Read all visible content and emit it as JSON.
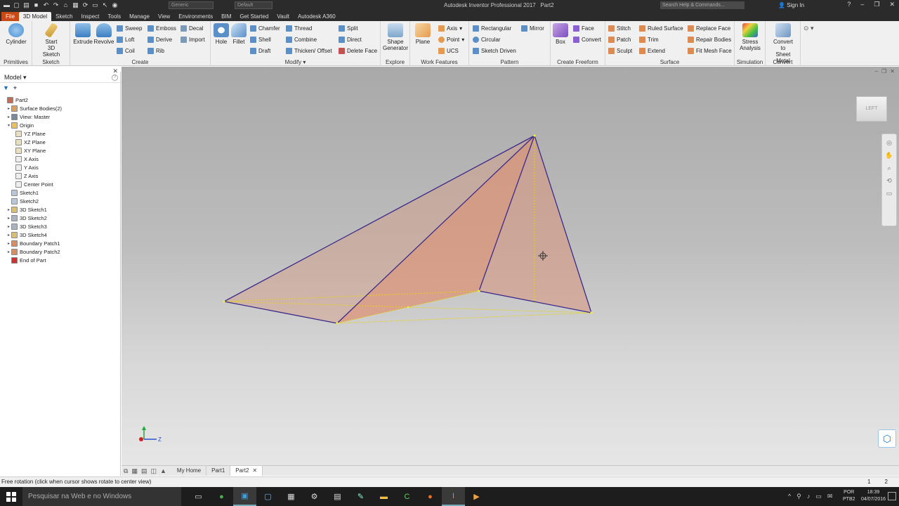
{
  "titlebar": {
    "appearance_combo": "Generic",
    "material_combo": "Default",
    "app_title": "Autodesk Inventor Professional 2017",
    "doc_title": "Part2",
    "search_placeholder": "Search Help & Commands...",
    "sign_in": "Sign In"
  },
  "tabs": [
    "File",
    "3D Model",
    "Sketch",
    "Inspect",
    "Tools",
    "Manage",
    "View",
    "Environments",
    "BIM",
    "Get Started",
    "Vault",
    "Autodesk A360"
  ],
  "active_tab": "3D Model",
  "ribbon": {
    "primitives": {
      "title": "Primitives",
      "cylinder": "Cylinder"
    },
    "sketch": {
      "title": "Sketch",
      "start_line1": "Start",
      "start_line2": "3D Sketch"
    },
    "create": {
      "title": "Create",
      "extrude": "Extrude",
      "revolve": "Revolve",
      "sweep": "Sweep",
      "emboss": "Emboss",
      "decal": "Decal",
      "loft": "Loft",
      "derive": "Derive",
      "import": "Import",
      "coil": "Coil",
      "rib": "Rib"
    },
    "modify": {
      "title": "Modify",
      "hole": "Hole",
      "fillet": "Fillet",
      "chamfer": "Chamfer",
      "thread": "Thread",
      "split": "Split",
      "shell": "Shell",
      "combine": "Combine",
      "direct": "Direct",
      "draft": "Draft",
      "thicken": "Thicken/ Offset",
      "delete_face": "Delete Face"
    },
    "explore": {
      "title": "Explore",
      "shape_line1": "Shape",
      "shape_line2": "Generator"
    },
    "work_features": {
      "title": "Work Features",
      "plane": "Plane",
      "axis": "Axis",
      "point": "Point",
      "ucs": "UCS"
    },
    "pattern": {
      "title": "Pattern",
      "rectangular": "Rectangular",
      "circular": "Circular",
      "sketch_driven": "Sketch Driven",
      "mirror": "Mirror"
    },
    "create_freeform": {
      "title": "Create Freeform",
      "box": "Box",
      "face": "Face",
      "convert": "Convert"
    },
    "surface": {
      "title": "Surface",
      "stitch": "Stitch",
      "ruled_surface": "Ruled Surface",
      "replace_face": "Replace Face",
      "patch": "Patch",
      "trim": "Trim",
      "repair_bodies": "Repair Bodies",
      "sculpt": "Sculpt",
      "extend": "Extend",
      "fit_mesh_face": "Fit Mesh Face"
    },
    "simulation": {
      "title": "Simulation",
      "stress_line1": "Stress",
      "stress_line2": "Analysis"
    },
    "convert": {
      "title": "Convert",
      "sheet_line1": "Convert to",
      "sheet_line2": "Sheet Metal"
    }
  },
  "browser": {
    "title": "Model",
    "tree": [
      {
        "label": "Part2",
        "indent": 0,
        "icon": "part-icon",
        "color": "#c86a5a"
      },
      {
        "label": "Surface Bodies(2)",
        "indent": 1,
        "icon": "surface-bodies-icon",
        "color": "#d9a060"
      },
      {
        "label": "View: Master",
        "indent": 1,
        "icon": "view-icon",
        "color": "#7a8a9a"
      },
      {
        "label": "Origin",
        "indent": 1,
        "icon": "folder-icon",
        "color": "#e8c060"
      },
      {
        "label": "YZ Plane",
        "indent": 2,
        "icon": "plane-icon",
        "color": "#e8e0c0"
      },
      {
        "label": "XZ Plane",
        "indent": 2,
        "icon": "plane-icon",
        "color": "#e8e0c0"
      },
      {
        "label": "XY Plane",
        "indent": 2,
        "icon": "plane-icon",
        "color": "#e8e0c0"
      },
      {
        "label": "X Axis",
        "indent": 2,
        "icon": "axis-icon",
        "color": "#eeeeee"
      },
      {
        "label": "Y Axis",
        "indent": 2,
        "icon": "axis-icon",
        "color": "#eeeeee"
      },
      {
        "label": "Z Axis",
        "indent": 2,
        "icon": "axis-icon",
        "color": "#eeeeee"
      },
      {
        "label": "Center Point",
        "indent": 2,
        "icon": "point-icon",
        "color": "#eeeeee"
      },
      {
        "label": "Sketch1",
        "indent": 1,
        "icon": "sketch-icon",
        "color": "#b8c8d8"
      },
      {
        "label": "Sketch2",
        "indent": 1,
        "icon": "sketch-icon",
        "color": "#b8c8d8"
      },
      {
        "label": "3D Sketch1",
        "indent": 1,
        "icon": "3d-sketch-icon",
        "color": "#d8c070"
      },
      {
        "label": "3D Sketch2",
        "indent": 1,
        "icon": "3d-sketch-icon",
        "color": "#aab4c0"
      },
      {
        "label": "3D Sketch3",
        "indent": 1,
        "icon": "3d-sketch-icon",
        "color": "#aab4c0"
      },
      {
        "label": "3D Sketch4",
        "indent": 1,
        "icon": "3d-sketch-icon",
        "color": "#d8c070"
      },
      {
        "label": "Boundary Patch1",
        "indent": 1,
        "icon": "boundary-patch-icon",
        "color": "#d98c60"
      },
      {
        "label": "Boundary Patch2",
        "indent": 1,
        "icon": "boundary-patch-icon",
        "color": "#d98c60"
      },
      {
        "label": "End of Part",
        "indent": 1,
        "icon": "end-of-part-icon",
        "color": "#d03030"
      }
    ]
  },
  "viewcube_label": "LEFT",
  "doc_tabs": [
    "My Home",
    "Part1",
    "Part2"
  ],
  "active_doc": "Part2",
  "status": {
    "message": "Free rotation (click when cursor shows rotate to center view)",
    "num1": "1",
    "num2": "2"
  },
  "taskbar": {
    "search": "Pesquisar na Web e no Windows",
    "lang_line1": "POR",
    "lang_line2": "PTB2",
    "time": "18:39",
    "date": "04/07/2016"
  },
  "colors": {
    "file_tab": "#c84a16",
    "surface_fill": "#d8906c",
    "edge": "#3a2a8a",
    "sketch_line": "#e8d800"
  }
}
